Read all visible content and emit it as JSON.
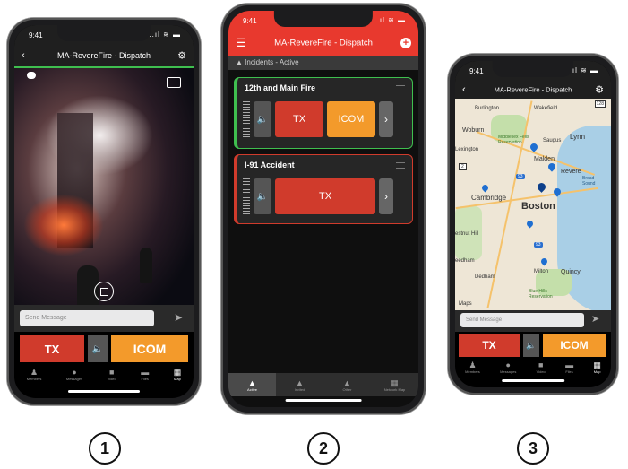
{
  "phone1": {
    "time": "9:41",
    "signal": "..ıl ≋ ▬",
    "title": "MA-RevereFire - Dispatch",
    "back_icon": "chevron-left-icon",
    "settings_icon": "gear-icon",
    "chat_icon": "chat-bubble-icon",
    "camera_switch_icon": "camera-switch-icon",
    "message_placeholder": "Send Message",
    "tx_label": "TX",
    "icom_label": "ICOM",
    "tabs": [
      {
        "label": "Members",
        "icon": "members-icon"
      },
      {
        "label": "Messages",
        "icon": "messages-icon"
      },
      {
        "label": "Video",
        "icon": "video-icon"
      },
      {
        "label": "Files",
        "icon": "files-icon"
      },
      {
        "label": "Map",
        "icon": "map-icon"
      }
    ]
  },
  "phone2": {
    "time": "9:41",
    "signal": "..ıl ≋ ▬",
    "title": "MA-RevereFire - Dispatch",
    "section": "Incidents - Active",
    "cards": [
      {
        "title": "12th and Main Fire",
        "tx_label": "TX",
        "icom_label": "ICOM"
      },
      {
        "title": "I-91 Accident",
        "tx_label": "TX"
      }
    ],
    "tabs": [
      {
        "label": "Active",
        "icon": "active-incident-icon"
      },
      {
        "label": "Invited",
        "icon": "invited-icon"
      },
      {
        "label": "Other",
        "icon": "other-icon"
      },
      {
        "label": "Network Map",
        "icon": "network-map-icon"
      }
    ]
  },
  "phone3": {
    "time": "9:41",
    "signal": "..ıl ≋ ▬",
    "title": "MA-RevereFire - Dispatch",
    "map_labels": {
      "burlington": "Burlington",
      "wakefield": "Wakefield",
      "woburn": "Woburn",
      "middlesex": "Middlesex Fells Reservation",
      "saugus": "Saugus",
      "lynn": "Lynn",
      "lexington": "Lexington",
      "malden": "Malden",
      "revere": "Revere",
      "cambridge": "Cambridge",
      "boston": "Boston",
      "estnut_hill": "estnut Hill",
      "quincy": "Quincy",
      "milton": "Milton",
      "dedham": "Dedham",
      "blue_hills": "Blue Hills Reservation",
      "needham": "eedham",
      "maps": "Maps",
      "hwy_93": "93",
      "hwy_2": "2",
      "hwy_128": "128",
      "broad_sound": "Broad Sound"
    },
    "message_placeholder": "Send Message",
    "tx_label": "TX",
    "icom_label": "ICOM",
    "tabs": [
      {
        "label": "Members",
        "icon": "members-icon"
      },
      {
        "label": "Messages",
        "icon": "messages-icon"
      },
      {
        "label": "Video",
        "icon": "video-icon"
      },
      {
        "label": "Files",
        "icon": "files-icon"
      },
      {
        "label": "Map",
        "icon": "map-icon"
      }
    ]
  },
  "captions": [
    "1",
    "2",
    "3"
  ],
  "colors": {
    "tx": "#d03b2c",
    "icom": "#f39a2b",
    "accent_green": "#3fbf4f",
    "header_red": "#e8392e"
  }
}
